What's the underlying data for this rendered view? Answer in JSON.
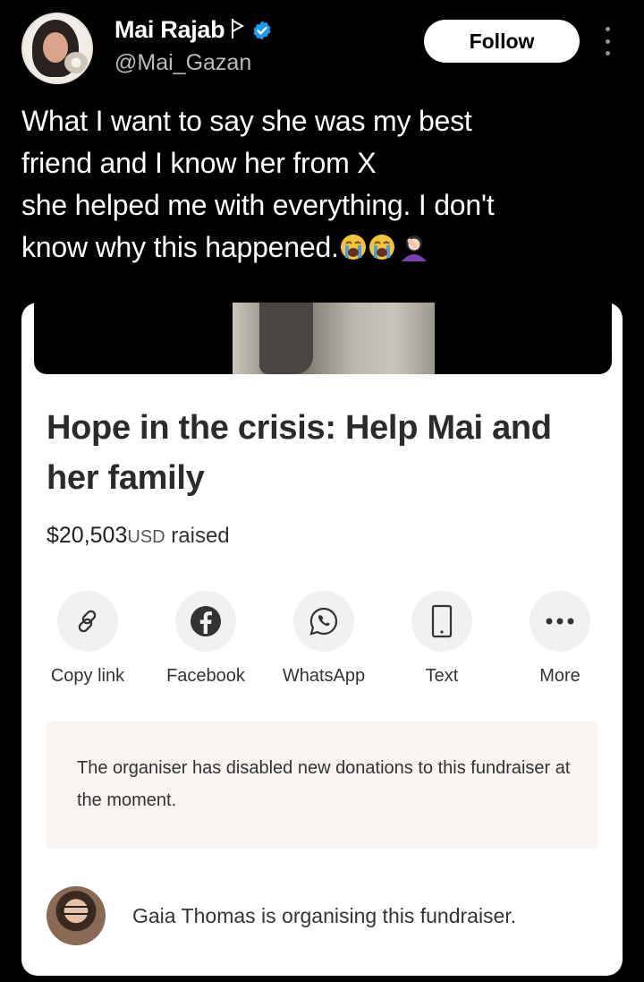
{
  "author": {
    "name": "Mai Rajab",
    "handle": "@Mai_Gazan",
    "follow_label": "Follow"
  },
  "tweet": {
    "lines": [
      "What I want to say she was my best",
      "friend and  I know her from X",
      "she helped me with everything. I don't",
      "know why this happened."
    ],
    "emojis": [
      "loudly-crying-face",
      "loudly-crying-face",
      "woman-facepalming"
    ]
  },
  "card": {
    "title": "Hope in the crisis: Help Mai and her family",
    "raised_amount": "$20,503",
    "raised_currency": "USD",
    "raised_suffix": "raised",
    "share": [
      {
        "label": "Copy link",
        "icon": "link-icon"
      },
      {
        "label": "Facebook",
        "icon": "facebook-icon"
      },
      {
        "label": "WhatsApp",
        "icon": "whatsapp-icon"
      },
      {
        "label": "Text",
        "icon": "phone-icon"
      },
      {
        "label": "More",
        "icon": "more-icon"
      }
    ],
    "notice": "The organiser has disabled new donations to this fundraiser at the moment.",
    "organiser": "Gaia Thomas is organising this fundraiser."
  },
  "colors": {
    "background": "#000000",
    "verified": "#1d9bf0",
    "handle": "#b9bcc0",
    "notice_bg": "#f8f4f1"
  }
}
